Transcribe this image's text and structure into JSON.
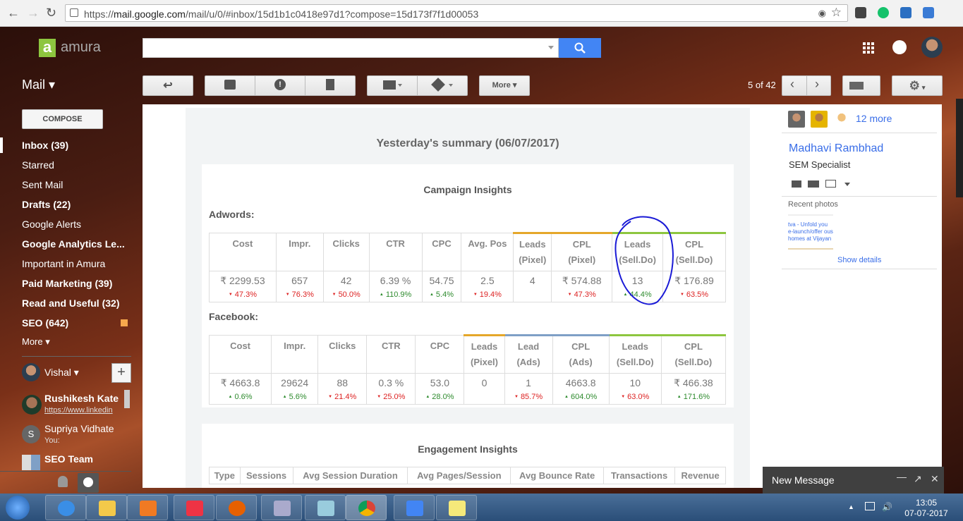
{
  "browser": {
    "url_prefix": "https://",
    "url_host": "mail.google.com",
    "url_path": "/mail/u/0/#inbox/15d1b1c0418e97d1?compose=15d173f7f1d00053"
  },
  "header": {
    "brand": "amura",
    "logo_letter": "a",
    "mail_label": "Mail ▾",
    "pager": "5 of 42",
    "more_label": "More ▾"
  },
  "sidebar": {
    "compose": "COMPOSE",
    "folders": [
      {
        "label": "Inbox (39)",
        "bold": true
      },
      {
        "label": "Starred",
        "bold": false
      },
      {
        "label": "Sent Mail",
        "bold": false
      },
      {
        "label": "Drafts (22)",
        "bold": true
      },
      {
        "label": "Google Alerts",
        "bold": false
      },
      {
        "label": "Google Analytics Le...",
        "bold": true
      },
      {
        "label": "Important in Amura",
        "bold": false
      },
      {
        "label": "Paid Marketing (39)",
        "bold": true
      },
      {
        "label": "Read and Useful (32)",
        "bold": true
      },
      {
        "label": "SEO (642)",
        "bold": true
      },
      {
        "label": "More ▾",
        "bold": false
      }
    ],
    "user": "Vishal ▾",
    "chats": [
      {
        "name": "Rushikesh Kate",
        "sub": "https://www.linkedin"
      },
      {
        "name": "Supriya Vidhate",
        "sub": "You:",
        "initial": "S"
      },
      {
        "name": "SEO Team",
        "sub": ""
      }
    ]
  },
  "email": {
    "summary": "Yesterday's summary (06/07/2017)",
    "campaign_title": "Campaign Insights",
    "adwords_label": "Adwords:",
    "adwords": {
      "headers": [
        [
          "Cost"
        ],
        [
          "Impr."
        ],
        [
          "Clicks"
        ],
        [
          "CTR"
        ],
        [
          "CPC"
        ],
        [
          "Avg. Pos"
        ],
        [
          "Leads",
          "(Pixel)"
        ],
        [
          "CPL",
          "(Pixel)"
        ],
        [
          "Leads",
          "(Sell.Do)"
        ],
        [
          "CPL",
          "(Sell.Do)"
        ]
      ],
      "values": [
        "₹ 2299.53",
        "657",
        "42",
        "6.39 %",
        "54.75",
        "2.5",
        "4",
        "₹ 574.88",
        "13",
        "₹ 176.89"
      ],
      "deltas": [
        {
          "t": "47.3%",
          "dir": "dn"
        },
        {
          "t": "76.3%",
          "dir": "dn"
        },
        {
          "t": "50.0%",
          "dir": "dn"
        },
        {
          "t": "110.9%",
          "dir": "up"
        },
        {
          "t": "5.4%",
          "dir": "up"
        },
        {
          "t": "19.4%",
          "dir": "dn"
        },
        {
          "t": "",
          "dir": ""
        },
        {
          "t": "47.3%",
          "dir": "dn"
        },
        {
          "t": "44.4%",
          "dir": "up"
        },
        {
          "t": "63.5%",
          "dir": "dn"
        }
      ]
    },
    "facebook_label": "Facebook:",
    "facebook": {
      "headers": [
        [
          "Cost"
        ],
        [
          "Impr."
        ],
        [
          "Clicks"
        ],
        [
          "CTR"
        ],
        [
          "CPC"
        ],
        [
          "Leads",
          "(Pixel)"
        ],
        [
          "Lead",
          "(Ads)"
        ],
        [
          "CPL",
          "(Ads)"
        ],
        [
          "Leads",
          "(Sell.Do)"
        ],
        [
          "CPL",
          "(Sell.Do)"
        ]
      ],
      "values": [
        "₹ 4663.8",
        "29624",
        "88",
        "0.3 %",
        "53.0",
        "0",
        "1",
        "4663.8",
        "10",
        "₹ 466.38"
      ],
      "deltas": [
        {
          "t": "0.6%",
          "dir": "up"
        },
        {
          "t": "5.6%",
          "dir": "up"
        },
        {
          "t": "21.4%",
          "dir": "dn"
        },
        {
          "t": "25.0%",
          "dir": "dn"
        },
        {
          "t": "28.0%",
          "dir": "up"
        },
        {
          "t": "",
          "dir": ""
        },
        {
          "t": "85.7%",
          "dir": "dn"
        },
        {
          "t": "604.0%",
          "dir": "up"
        },
        {
          "t": "63.0%",
          "dir": "dn"
        },
        {
          "t": "171.6%",
          "dir": "up"
        }
      ]
    },
    "engagement_title": "Engagement Insights",
    "engagement_headers": [
      "Type",
      "Sessions",
      "Avg Session Duration",
      "Avg Pages/Session",
      "Avg Bounce Rate",
      "Transactions",
      "Revenue"
    ]
  },
  "right": {
    "more_people": "12 more",
    "name": "Madhavi Rambhad",
    "title": "SEM Specialist",
    "recent_photos": "Recent photos",
    "thumb_text": "tva - Unfold you e-launch/offer ous homes at Vijayan",
    "show_details": "Show details"
  },
  "new_message": {
    "title": "New Message"
  },
  "taskbar": {
    "time": "13:05",
    "date": "07-07-2017"
  },
  "colors": {
    "accent_blue": "#4285f4",
    "up": "#2e8b2e",
    "down": "#dd2222",
    "amura_green": "#8dc63f"
  }
}
